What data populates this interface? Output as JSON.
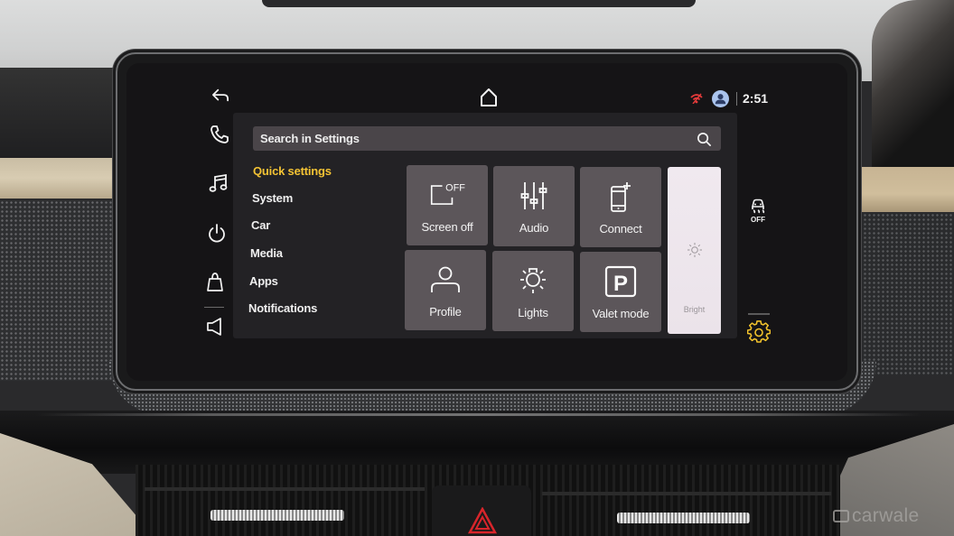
{
  "status_bar": {
    "time": "2:51",
    "icons": [
      "back-icon",
      "home-icon",
      "no-signal-icon",
      "user-avatar-icon"
    ]
  },
  "nav_rail": {
    "items": [
      {
        "name": "back",
        "icon": "back-arrow-icon"
      },
      {
        "name": "phone",
        "icon": "phone-icon"
      },
      {
        "name": "media",
        "icon": "music-note-icon"
      },
      {
        "name": "power",
        "icon": "power-icon"
      },
      {
        "name": "apps-store",
        "icon": "shopping-bag-icon"
      },
      {
        "name": "volume",
        "icon": "speaker-icon"
      }
    ]
  },
  "search": {
    "placeholder": "Search in Settings",
    "icon": "search-icon"
  },
  "settings_menu": {
    "active_index": 0,
    "items": [
      {
        "label": "Quick settings"
      },
      {
        "label": "System"
      },
      {
        "label": "Car"
      },
      {
        "label": "Media"
      },
      {
        "label": "Apps"
      },
      {
        "label": "Notifications"
      }
    ]
  },
  "quick_tiles": [
    {
      "label": "Screen off",
      "icon": "screen-off-icon",
      "icon_text": "OFF"
    },
    {
      "label": "Audio",
      "icon": "equalizer-sliders-icon"
    },
    {
      "label": "Connect",
      "icon": "phone-connect-icon"
    },
    {
      "label": "Profile",
      "icon": "profile-icon"
    },
    {
      "label": "Lights",
      "icon": "light-bulb-icon"
    },
    {
      "label": "Valet mode",
      "icon": "parking-p-icon",
      "icon_text": "P"
    }
  ],
  "brightness": {
    "label": "Bright",
    "level_fraction": 1.0
  },
  "right_rail": {
    "esc_off_label": "OFF",
    "icons": [
      "traction-control-off-icon",
      "settings-gear-icon"
    ]
  },
  "colors": {
    "accent": "#f4c334",
    "tile_bg": "#5c565a",
    "panel_bg": "#232225",
    "screen_bg": "#151416",
    "status_warning": "#e23a3a",
    "avatar_bg": "#aac4ee"
  },
  "watermark": "carwale"
}
